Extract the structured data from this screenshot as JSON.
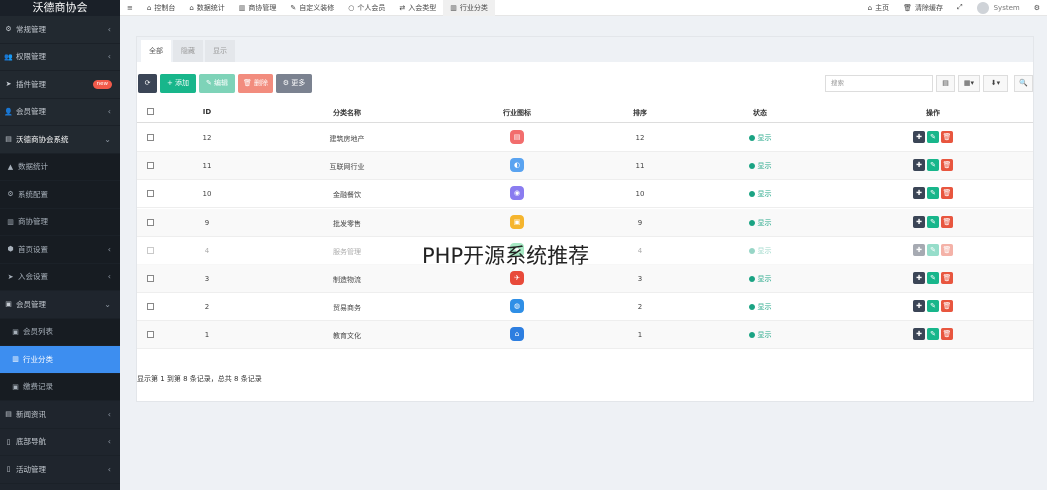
{
  "sidebar": {
    "brand": "沃德商协会",
    "items": [
      {
        "icon": "⚙",
        "label": "常规管理",
        "arrow": "‹"
      },
      {
        "icon": "👥",
        "label": "权限管理",
        "arrow": "‹"
      },
      {
        "icon": "➤",
        "label": "插件管理",
        "badge": "new"
      },
      {
        "icon": "👤",
        "label": "会员管理",
        "arrow": "‹"
      },
      {
        "icon": "▤",
        "label": "沃德商协会系统",
        "arrow": "⌄"
      },
      {
        "icon": "▲",
        "label": "数据统计"
      },
      {
        "icon": "⚙",
        "label": "系统配置"
      },
      {
        "icon": "▥",
        "label": "商协管理"
      },
      {
        "icon": "⬢",
        "label": "首页设置",
        "arrow": "‹"
      },
      {
        "icon": "➤",
        "label": "入会设置",
        "arrow": "‹"
      },
      {
        "icon": "▣",
        "label": "会员管理",
        "arrow": "⌄"
      },
      {
        "icon": "▣",
        "label": "会员列表"
      },
      {
        "icon": "▥",
        "label": "行业分类"
      },
      {
        "icon": "▣",
        "label": "缴费记录"
      },
      {
        "icon": "▤",
        "label": "新闻资讯",
        "arrow": "‹"
      },
      {
        "icon": "▯",
        "label": "底部导航",
        "arrow": "‹"
      },
      {
        "icon": "▯",
        "label": "活动管理",
        "arrow": "‹"
      }
    ]
  },
  "topbar": {
    "menu_icon": "≡",
    "tabs": [
      {
        "icon": "⌂",
        "label": "控制台"
      },
      {
        "icon": "⌂",
        "label": "数据统计"
      },
      {
        "icon": "▥",
        "label": "商协管理"
      },
      {
        "icon": "✎",
        "label": "自定义装修"
      },
      {
        "icon": "○",
        "label": "个人会员"
      },
      {
        "icon": "⇄",
        "label": "入会类型"
      },
      {
        "icon": "▥",
        "label": "行业分类"
      }
    ],
    "home": "主页",
    "clear_cache": "清除缓存",
    "fullscreen_icon": "⤢",
    "user": "System",
    "settings_icon": "⚙"
  },
  "panel": {
    "tabs": [
      "全部",
      "隐藏",
      "显示"
    ],
    "toolbar": {
      "refresh": "⟳",
      "add": "+ 添加",
      "edit": "✎ 编辑",
      "delete": "🗑 删除",
      "more": "⚙ 更多",
      "search_placeholder": "搜索",
      "view_icons": [
        "▤",
        "▦▾",
        "⬇▾",
        "🔍"
      ]
    },
    "columns": [
      "ID",
      "分类名称",
      "行业图标",
      "排序",
      "状态",
      "操作"
    ],
    "rows": [
      {
        "id": "12",
        "name": "建筑房地产",
        "icon": "▤",
        "color": "#f26d6d",
        "sort": "12",
        "status": "显示"
      },
      {
        "id": "11",
        "name": "互联网行业",
        "icon": "◐",
        "color": "#5aa3f0",
        "sort": "11",
        "status": "显示"
      },
      {
        "id": "10",
        "name": "金融餐饮",
        "icon": "◉",
        "color": "#8a7cf0",
        "sort": "10",
        "status": "显示"
      },
      {
        "id": "9",
        "name": "批发零售",
        "icon": "▣",
        "color": "#f5b52e",
        "sort": "9",
        "status": "显示"
      },
      {
        "id": "4",
        "name": "服务管理",
        "icon": "✚",
        "color": "#3ccf7e",
        "sort": "4",
        "status": "显示"
      },
      {
        "id": "3",
        "name": "制造物流",
        "icon": "✈",
        "color": "#e84a3a",
        "sort": "3",
        "status": "显示"
      },
      {
        "id": "2",
        "name": "贸易商务",
        "icon": "◍",
        "color": "#2f8fe6",
        "sort": "2",
        "status": "显示"
      },
      {
        "id": "1",
        "name": "教育文化",
        "icon": "⌂",
        "color": "#2d7ee0",
        "sort": "1",
        "status": "显示"
      }
    ],
    "footer": "显示第 1 到第 8 条记录，总共 8 条记录"
  },
  "watermark": "PHP开源系统推荐",
  "colors": {
    "sidebar_bg": "#1f252d",
    "active": "#3d8ef0",
    "add": "#18b68b",
    "edit": "#7ed3b8",
    "delete": "#f28c7e",
    "more": "#7b8290",
    "refresh": "#3b4556",
    "op_move": "#3b4556",
    "op_edit": "#18b68b",
    "op_delete": "#e8563f"
  }
}
